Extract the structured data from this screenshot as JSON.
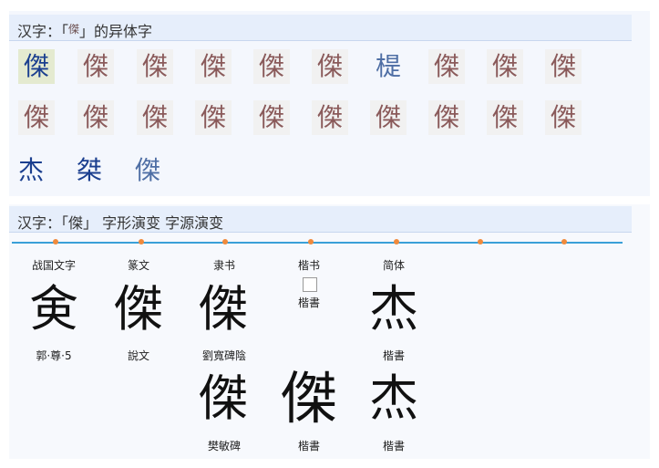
{
  "section1": {
    "title_prefix": "汉字：「",
    "title_glyph": "傑",
    "title_suffix": "」的异体字",
    "row1": [
      "傑",
      "傑",
      "傑",
      "傑",
      "傑",
      "傑",
      "㮛",
      "傑",
      "傑",
      "傑"
    ],
    "row2": [
      "傑",
      "傑",
      "傑",
      "傑",
      "傑",
      "傑",
      "傑",
      "傑",
      "傑",
      "傑"
    ],
    "row3": [
      "杰",
      "桀",
      "傑"
    ]
  },
  "section2": {
    "title": "汉字：「傑」 字形演变 字源演变",
    "stages": [
      "战国文字",
      "篆文",
      "隶书",
      "楷书",
      "简体"
    ],
    "row1": [
      {
        "char": "㑒",
        "caption": "郭·尊·5"
      },
      {
        "char": "傑",
        "caption": "說文"
      },
      {
        "char": "傑",
        "caption": "劉寬碑陰"
      },
      {
        "char": "",
        "caption": "楷書"
      },
      {
        "char": "杰",
        "caption": "楷書"
      }
    ],
    "row2": [
      {
        "char": "傑",
        "caption": "樊敏碑"
      },
      {
        "char": "傑",
        "caption": "楷書"
      },
      {
        "char": "杰",
        "caption": "楷書"
      }
    ]
  },
  "colors": {
    "timeline": "#3aa0d8",
    "dot": "#f08a3c",
    "header": "#e6eefb"
  }
}
